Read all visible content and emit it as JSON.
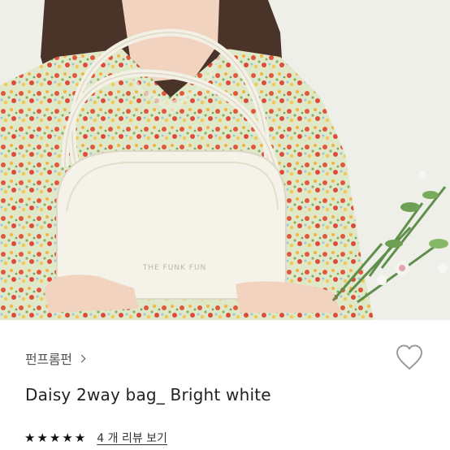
{
  "product": {
    "brand": "펀프롬펀",
    "title": "Daisy 2way bag_ Bright white",
    "rating": 5,
    "review_link": "4 개 리뷰 보기"
  },
  "photo": {
    "bag_brand_mark": "THE FUNK FUN"
  },
  "icons": {
    "brand_chevron": "chevron-right-icon",
    "wishlist": "heart-outline-icon",
    "rating_star": "star-icon"
  },
  "colors": {
    "text_primary": "#222222",
    "text_secondary": "#555555",
    "background": "#ffffff",
    "photo_background": "#eeefe9"
  }
}
